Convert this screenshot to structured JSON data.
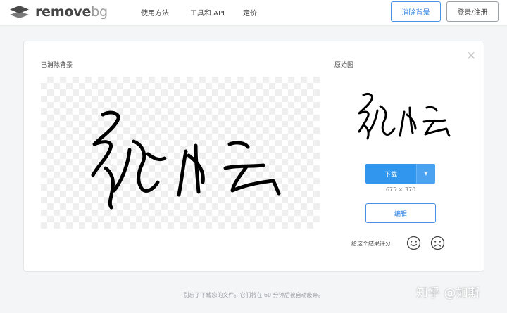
{
  "header": {
    "logo_text": "remove",
    "logo_suffix": "bg",
    "nav": [
      "使用方法",
      "工具和 API",
      "定价"
    ],
    "remove_bg_button": "消除背景",
    "login_button": "登录/注册"
  },
  "card": {
    "result_label": "已消除背景",
    "original_label": "原始图",
    "download_label": "下载",
    "dimensions": "675 × 370",
    "edit_label": "编辑",
    "rate_label": "给这个结果评分:"
  },
  "footer": {
    "note": "别忘了下载您的文件。它们将在 60 分钟后被自动废弃。"
  },
  "watermark": "知乎 @如斯",
  "colors": {
    "accent": "#3196ee",
    "link": "#2d7fe0"
  }
}
